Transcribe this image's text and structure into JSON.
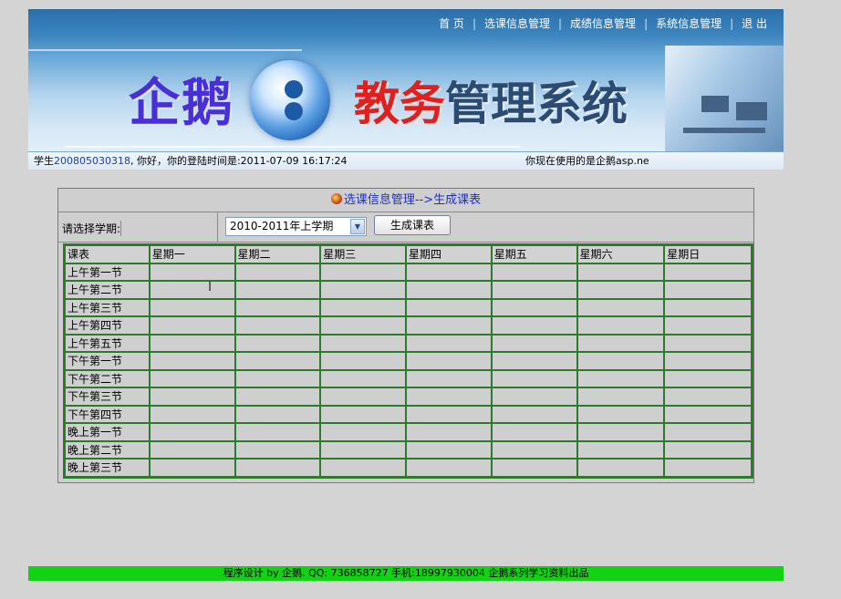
{
  "nav": {
    "items": [
      "首 页",
      "选课信息管理",
      "成绩信息管理",
      "系统信息管理",
      "退 出"
    ]
  },
  "banner": {
    "logo_text": "企鹅",
    "title_part1": "教务",
    "title_part2": "管理系统"
  },
  "status": {
    "prefix": "学生",
    "student_id": "200805030318",
    "greeting": ", 你好，你的登陆时间是:2011-07-09 16:17:24",
    "platform": "你现在使用的是企鹅asp.ne"
  },
  "panel": {
    "title": "选课信息管理-->生成课表",
    "semester_label": "请选择学期:",
    "semester_value": "2010-2011年上学期",
    "generate_button": "生成课表"
  },
  "timetable": {
    "headers": [
      "课表",
      "星期一",
      "星期二",
      "星期三",
      "星期四",
      "星期五",
      "星期六",
      "星期日"
    ],
    "periods": [
      "上午第一节",
      "上午第二节",
      "上午第三节",
      "上午第四节",
      "上午第五节",
      "下午第一节",
      "下午第二节",
      "下午第三节",
      "下午第四节",
      "晚上第一节",
      "晚上第二节",
      "晚上第三节"
    ]
  },
  "footer": {
    "text": "程序设计 by 企鹅. QQ: 736858727 手机:18997930004 企鹅系列学习资料出品"
  },
  "colors": {
    "accent_blue": "#1b2fd0",
    "table_border": "#2d7a2d",
    "footer_bg": "#13d113",
    "title_red": "#e0201f"
  }
}
